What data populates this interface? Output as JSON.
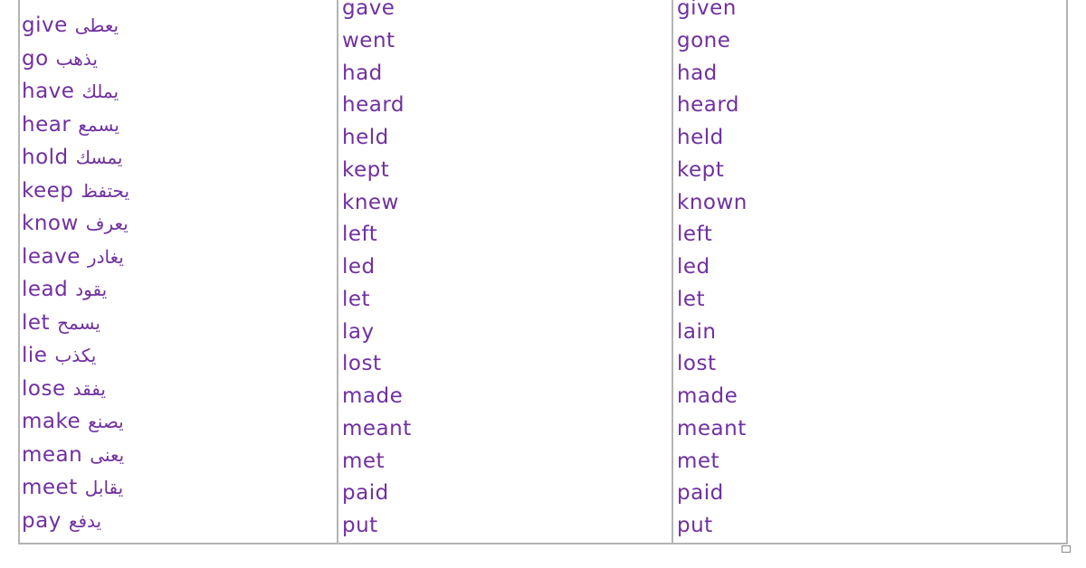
{
  "base_forms": [
    {
      "en": "give",
      "ar": "يعطى"
    },
    {
      "en": "go",
      "ar": "يذهب"
    },
    {
      "en": "have",
      "ar": "يملك"
    },
    {
      "en": "hear",
      "ar": "يسمع"
    },
    {
      "en": "hold",
      "ar": "يمسك"
    },
    {
      "en": "keep",
      "ar": "يحتفظ"
    },
    {
      "en": "know",
      "ar": "يعرف"
    },
    {
      "en": "leave",
      "ar": "يغادر"
    },
    {
      "en": "lead",
      "ar": "يقود"
    },
    {
      "en": "let",
      "ar": "يسمح"
    },
    {
      "en": "lie",
      "ar": "يكذب"
    },
    {
      "en": "lose",
      "ar": "يفقد"
    },
    {
      "en": "make",
      "ar": "يصنع"
    },
    {
      "en": "mean",
      "ar": "يعنى"
    },
    {
      "en": "meet",
      "ar": "يقابل"
    },
    {
      "en": "pay",
      "ar": "يدفع"
    }
  ],
  "past_simple": [
    "gave",
    "went",
    "had",
    "heard",
    "held",
    "kept",
    "knew",
    "left",
    "led",
    "let",
    "lay",
    "lost",
    "made",
    "meant",
    "met",
    "paid",
    "put"
  ],
  "past_participle": [
    "given",
    "gone",
    "had",
    "heard",
    "held",
    "kept",
    "known",
    "left",
    "led",
    "let",
    "lain",
    "lost",
    "made",
    "meant",
    "met",
    "paid",
    "put"
  ],
  "text_color": "#7030a0"
}
